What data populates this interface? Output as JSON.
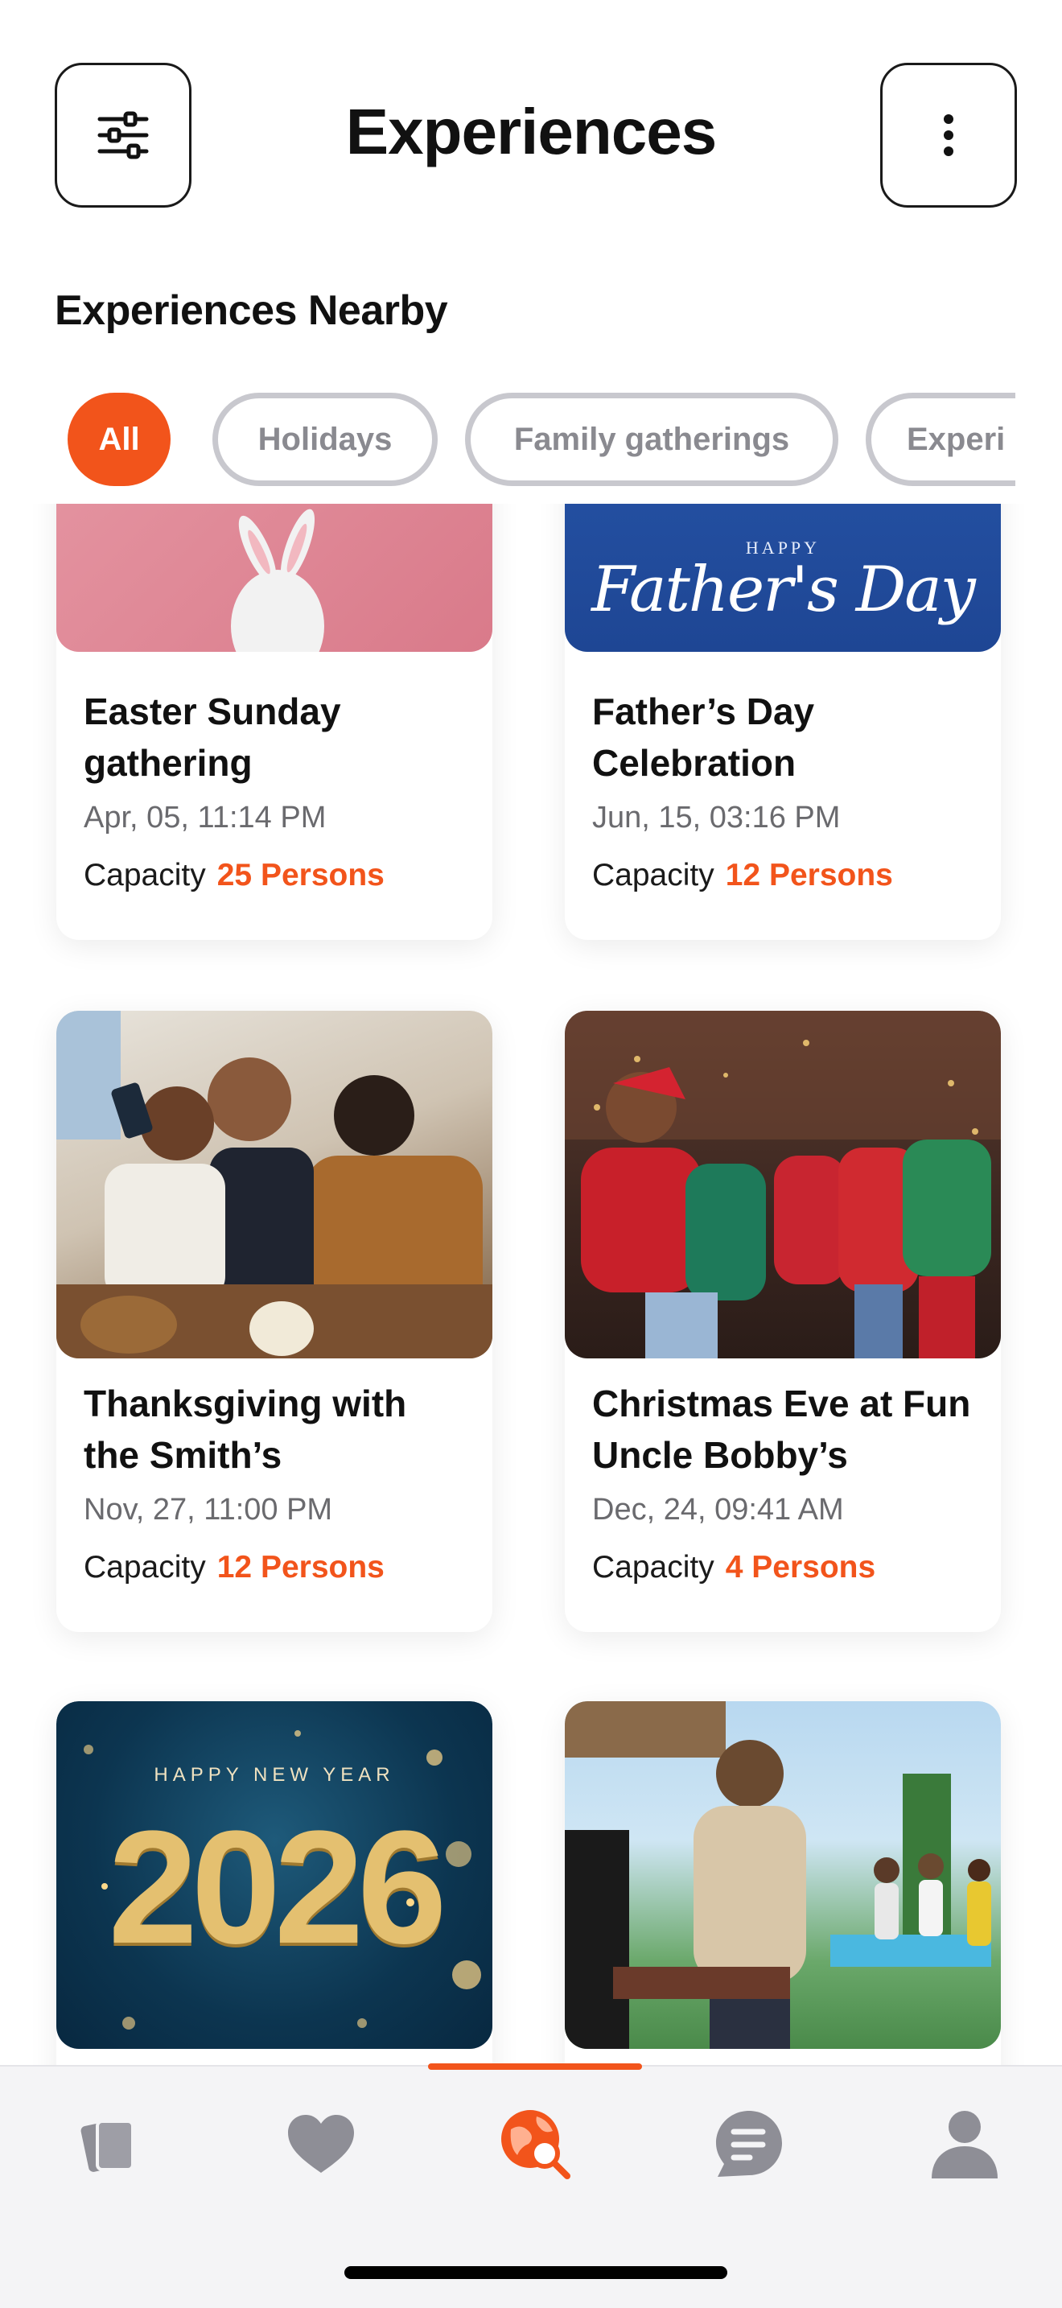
{
  "header": {
    "title": "Experiences",
    "filter_icon": "sliders-icon",
    "more_icon": "vertical-dots-icon"
  },
  "section": {
    "title": "Experiences Nearby"
  },
  "chips": [
    {
      "label": "All",
      "active": true
    },
    {
      "label": "Holidays",
      "active": false
    },
    {
      "label": "Family gatherings",
      "active": false
    },
    {
      "label": "Experi",
      "active": false
    }
  ],
  "cards": [
    {
      "title_line1": "Easter Sunday",
      "title_line2": "gathering",
      "date": "Apr, 05, 11:14 PM",
      "capacity_label": "Capacity",
      "capacity_value": "25 Persons",
      "image": "easter-bunny-egg-image"
    },
    {
      "title_line1": "Father’s Day",
      "title_line2": "Celebration",
      "date": "Jun, 15, 03:16 PM",
      "capacity_label": "Capacity",
      "capacity_value": "12 Persons",
      "image": "fathers-day-banner-image",
      "image_text_small": "HAPPY",
      "image_text_script": "Father's Day"
    },
    {
      "title_line1": "Thanksgiving with",
      "title_line2": "the Smith’s",
      "date": "Nov, 27, 11:00 PM",
      "capacity_label": "Capacity",
      "capacity_value": "12 Persons",
      "image": "thanksgiving-selfie-photo"
    },
    {
      "title_line1": "Christmas Eve at Fun",
      "title_line2": "Uncle Bobby’s",
      "date": "Dec, 24, 09:41 AM",
      "capacity_label": "Capacity",
      "capacity_value": "4 Persons",
      "image": "christmas-party-photo"
    },
    {
      "image": "new-year-2026-image",
      "image_text_small": "HAPPY NEW YEAR",
      "image_text_big": "2026"
    },
    {
      "image": "backyard-bbq-party-photo"
    }
  ],
  "tabbar": {
    "items": [
      {
        "icon": "cards-icon",
        "active": false
      },
      {
        "icon": "heart-icon",
        "active": false
      },
      {
        "icon": "globe-search-icon",
        "active": true
      },
      {
        "icon": "chat-bubble-icon",
        "active": false
      },
      {
        "icon": "profile-icon",
        "active": false
      }
    ]
  },
  "colors": {
    "accent": "#f2541b",
    "chip_border": "#c8c8ce",
    "muted_text": "#6a6a6e",
    "tab_icon": "#8e8e96"
  }
}
